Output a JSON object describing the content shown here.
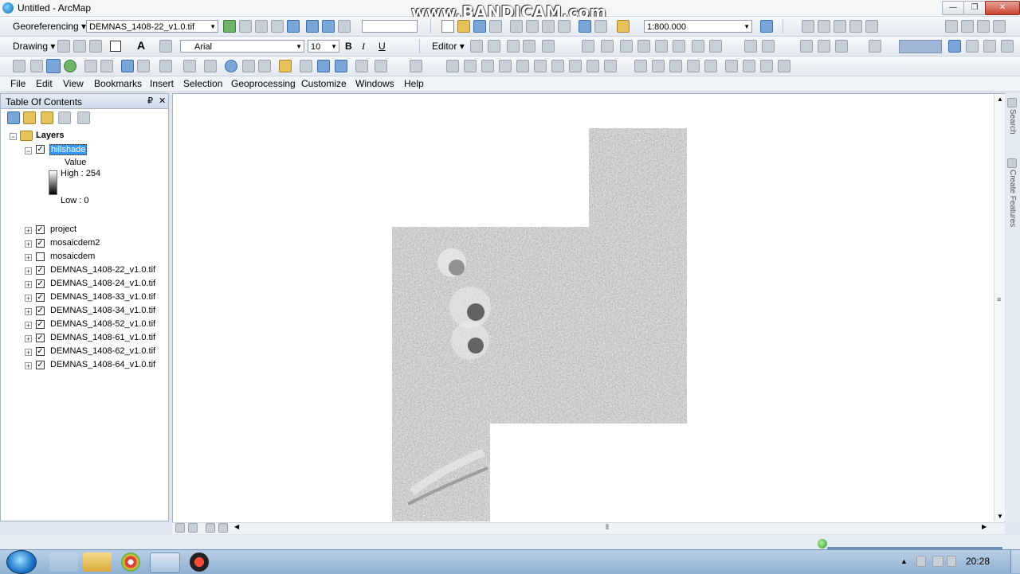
{
  "window": {
    "title": "Untitled - ArcMap",
    "minimize": "—",
    "maximize": "❐",
    "close": "✕"
  },
  "watermark": "www.BANDICAM.com",
  "toolbar1": {
    "georef_label": "Georeferencing",
    "georef_layer": "DEMNAS_1408-22_v1.0.tif",
    "scale": "1:800.000"
  },
  "toolbar2": {
    "drawing_label": "Drawing",
    "font_name": "Arial",
    "font_size": "10",
    "bold": "B",
    "italic": "I",
    "underline": "U",
    "editor_label": "Editor"
  },
  "menu": [
    "File",
    "Edit",
    "View",
    "Bookmarks",
    "Insert",
    "Selection",
    "Geoprocessing",
    "Customize",
    "Windows",
    "Help"
  ],
  "toc": {
    "title": "Table Of Contents",
    "pin": "₽",
    "close": "✕",
    "root": "Layers",
    "selected_layer": "hillshade",
    "legend_title": "Value",
    "legend_high": "High : 254",
    "legend_low": "Low : 0",
    "layers": [
      {
        "name": "project",
        "checked": true
      },
      {
        "name": "mosaicdem2",
        "checked": true
      },
      {
        "name": "mosaicdem",
        "checked": false
      },
      {
        "name": "DEMNAS_1408-22_v1.0.tif",
        "checked": true
      },
      {
        "name": "DEMNAS_1408-24_v1.0.tif",
        "checked": true
      },
      {
        "name": "DEMNAS_1408-33_v1.0.tif",
        "checked": true
      },
      {
        "name": "DEMNAS_1408-34_v1.0.tif",
        "checked": true
      },
      {
        "name": "DEMNAS_1408-52_v1.0.tif",
        "checked": true
      },
      {
        "name": "DEMNAS_1408-61_v1.0.tif",
        "checked": true
      },
      {
        "name": "DEMNAS_1408-62_v1.0.tif",
        "checked": true
      },
      {
        "name": "DEMNAS_1408-64_v1.0.tif",
        "checked": true
      }
    ]
  },
  "side_tabs": {
    "search": "Search",
    "create_features": "Create Features"
  },
  "taskbar": {
    "time": "20:28"
  }
}
